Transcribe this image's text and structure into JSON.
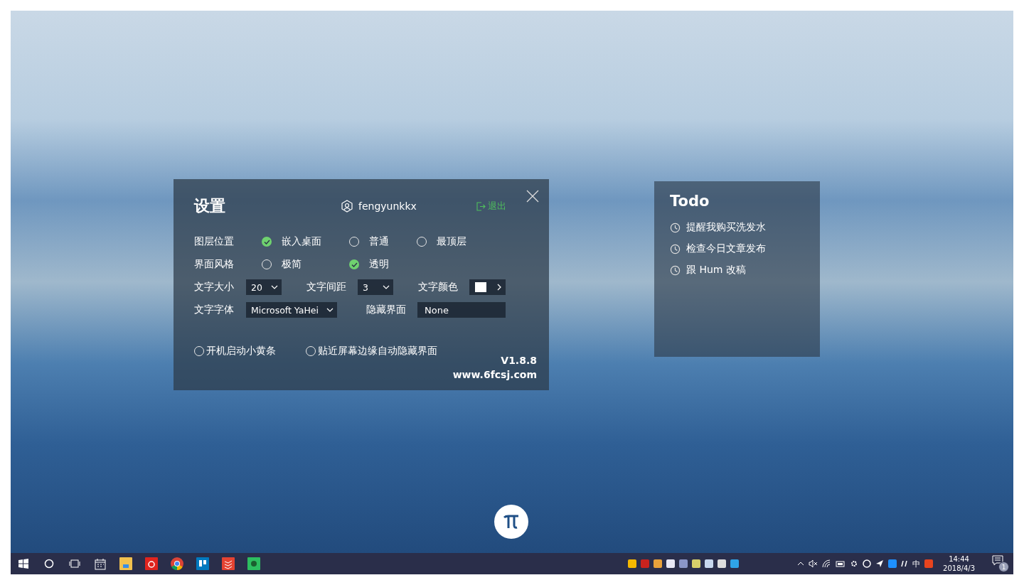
{
  "settings": {
    "title": "设置",
    "user": "fengyunkkx",
    "logout": "退出",
    "radio_rows": [
      {
        "label": "图层位置",
        "options": [
          {
            "label": "嵌入桌面",
            "selected": true
          },
          {
            "label": "普通",
            "selected": false
          },
          {
            "label": "最顶层",
            "selected": false
          }
        ]
      },
      {
        "label": "界面风格",
        "options": [
          {
            "label": "极简",
            "selected": false
          },
          {
            "label": "透明",
            "selected": true
          }
        ]
      }
    ],
    "font_size": {
      "label": "文字大小",
      "value": "20"
    },
    "spacing": {
      "label": "文字间距",
      "value": "3"
    },
    "text_color": {
      "label": "文字颜色",
      "color": "#ffffff"
    },
    "font": {
      "label": "文字字体",
      "value": "Microsoft YaHei"
    },
    "hide": {
      "label": "隐藏界面",
      "value": "None"
    },
    "checkboxes": [
      {
        "label": "开机启动小黄条",
        "checked": false
      },
      {
        "label": "贴近屏幕边缘自动隐藏界面",
        "checked": false
      }
    ],
    "version": "V1.8.8",
    "website": "www.6fcsj.com"
  },
  "todo": {
    "title": "Todo",
    "items": [
      "提醒我购买洗发水",
      "检查今日文章发布",
      "跟 Hum 改稿"
    ]
  },
  "taskbar": {
    "ime": "中",
    "time": "14:44",
    "date": "2018/4/3",
    "notifications": "1"
  }
}
